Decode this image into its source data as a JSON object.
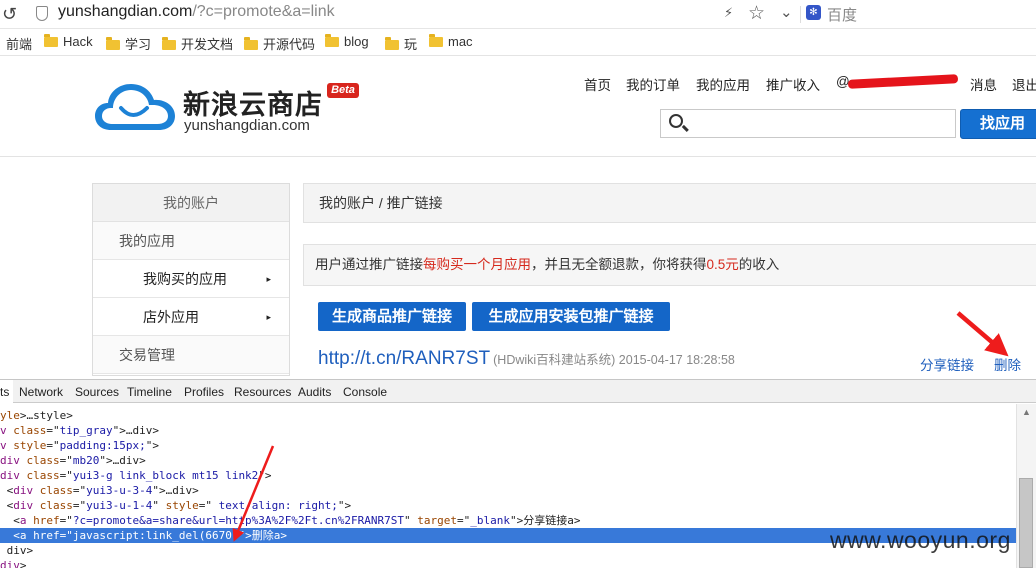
{
  "browser": {
    "url_domain": "yunshangdian.com",
    "url_query": "/?c=promote&a=link",
    "search_engine": "百度"
  },
  "bookmarks": [
    {
      "label": "前端",
      "folder": false
    },
    {
      "label": "Hack",
      "folder": true
    },
    {
      "label": "学习",
      "folder": true
    },
    {
      "label": "开发文档",
      "folder": true
    },
    {
      "label": "开源代码",
      "folder": true
    },
    {
      "label": "blog",
      "folder": true
    },
    {
      "label": "玩",
      "folder": true
    },
    {
      "label": "mac",
      "folder": true
    }
  ],
  "header": {
    "logo_cn": "新浪云商店",
    "logo_en": "yunshangdian.com",
    "beta": "Beta",
    "nav": [
      "首页",
      "我的订单",
      "我的应用",
      "推广收入",
      "@",
      "消息",
      "退出"
    ],
    "search_placeholder": "",
    "search_button": "找应用",
    "colors": {
      "brand_blue": "#1570d1",
      "beta_red": "#d8251d"
    }
  },
  "sidebar": {
    "title": "我的账户",
    "items": [
      {
        "label": "我的应用",
        "level": 1
      },
      {
        "label": "我购买的应用",
        "level": 2,
        "arrow": "▸"
      },
      {
        "label": "店外应用",
        "level": 2,
        "arrow": "▸"
      },
      {
        "label": "交易管理",
        "level": 1
      }
    ]
  },
  "main": {
    "breadcrumb": "我的账户 / 推广链接",
    "tip": {
      "part1": "用户通过推广链接",
      "highlight1": "每购买一个月应用",
      "part2": "，并且无全额退款，你将获得",
      "highlight2": "0.5元",
      "part3": "的收入"
    },
    "buttons": [
      "生成商品推广链接",
      "生成应用安装包推广链接"
    ],
    "link": {
      "url": "http://t.cn/RANR7ST",
      "meta": "(HDwiki百科建站系统) 2015-04-17 18:28:58",
      "share": "分享链接",
      "delete": "删除"
    }
  },
  "devtools": {
    "tabs": [
      "ts",
      "Network",
      "Sources",
      "Timeline",
      "Profiles",
      "Resources",
      "Audits",
      "Console"
    ],
    "active_tab": "ts",
    "lines": [
      {
        "indent": "",
        "html": "<span class='an'>yle</span>>…</<span class='tag'>style</span>>"
      },
      {
        "indent": "",
        "html": "<span class='tag'>v</span> <span class='an'>class</span>=\"<span class='av'>tip_gray</span>\">…</<span class='tag'>div</span>>"
      },
      {
        "indent": "",
        "html": "<span class='tag'>v</span> <span class='an'>style</span>=\"<span class='av'>padding:15px;</span>\">"
      },
      {
        "indent": "",
        "html": "<span class='tag'>div</span> <span class='an'>class</span>=\"<span class='av'>mb20</span>\">…</<span class='tag'>div</span>>"
      },
      {
        "indent": "",
        "html": "<span class='tag'>div</span> <span class='an'>class</span>=\"<span class='av'>yui3-g link_block mt15 link2</span>\">"
      },
      {
        "indent": " ",
        "html": "<<span class='tag'>div</span> <span class='an'>class</span>=\"<span class='av'>yui3-u-3-4</span>\">…</<span class='tag'>div</span>>"
      },
      {
        "indent": " ",
        "html": "<<span class='tag'>div</span> <span class='an'>class</span>=\"<span class='av'>yui3-u-1-4</span>\" <span class='an'>style</span>=\"<span class='av'> text-align: right;</span>\">"
      },
      {
        "indent": "  ",
        "html": "<<span class='tag'>a</span> <span class='an'>href</span>=\"<span class='av'>?c=promote&amp;a=share&amp;url=http%3A%2F%2Ft.cn%2FRANR7ST</span>\" <span class='an'>target</span>=\"<span class='av'>_blank</span>\">分享链接</<span class='tag'>a</span>>"
      },
      {
        "indent": "  ",
        "html": "<<span class='tag'>a</span> <span class='an'>href</span>=\"<span class='av'>javascript:link_del(6670)</span>\">删除</<span class='tag'>a</span>>",
        "selected": true
      },
      {
        "indent": " ",
        "html": "</<span class='tag'>div</span>>"
      },
      {
        "indent": "",
        "html": "<span class='tag'>div</span>>"
      }
    ]
  },
  "watermark": "www.wooyun.org",
  "annotation_color": "#ee1c1c"
}
